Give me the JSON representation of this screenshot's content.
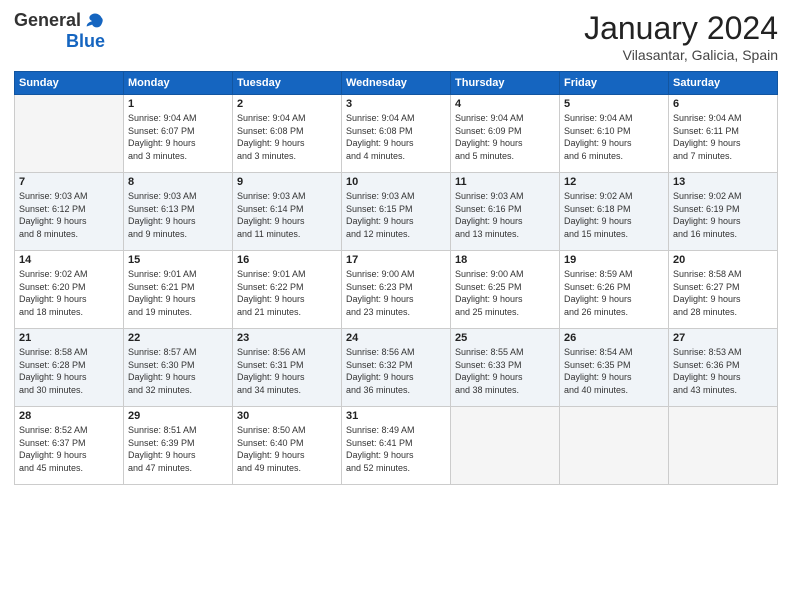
{
  "header": {
    "logo_general": "General",
    "logo_blue": "Blue",
    "month_title": "January 2024",
    "location": "Vilasantar, Galicia, Spain"
  },
  "days_of_week": [
    "Sunday",
    "Monday",
    "Tuesday",
    "Wednesday",
    "Thursday",
    "Friday",
    "Saturday"
  ],
  "weeks": [
    [
      {
        "day": "",
        "info": ""
      },
      {
        "day": "1",
        "info": "Sunrise: 9:04 AM\nSunset: 6:07 PM\nDaylight: 9 hours\nand 3 minutes."
      },
      {
        "day": "2",
        "info": "Sunrise: 9:04 AM\nSunset: 6:08 PM\nDaylight: 9 hours\nand 3 minutes."
      },
      {
        "day": "3",
        "info": "Sunrise: 9:04 AM\nSunset: 6:08 PM\nDaylight: 9 hours\nand 4 minutes."
      },
      {
        "day": "4",
        "info": "Sunrise: 9:04 AM\nSunset: 6:09 PM\nDaylight: 9 hours\nand 5 minutes."
      },
      {
        "day": "5",
        "info": "Sunrise: 9:04 AM\nSunset: 6:10 PM\nDaylight: 9 hours\nand 6 minutes."
      },
      {
        "day": "6",
        "info": "Sunrise: 9:04 AM\nSunset: 6:11 PM\nDaylight: 9 hours\nand 7 minutes."
      }
    ],
    [
      {
        "day": "7",
        "info": "Sunrise: 9:03 AM\nSunset: 6:12 PM\nDaylight: 9 hours\nand 8 minutes."
      },
      {
        "day": "8",
        "info": "Sunrise: 9:03 AM\nSunset: 6:13 PM\nDaylight: 9 hours\nand 9 minutes."
      },
      {
        "day": "9",
        "info": "Sunrise: 9:03 AM\nSunset: 6:14 PM\nDaylight: 9 hours\nand 11 minutes."
      },
      {
        "day": "10",
        "info": "Sunrise: 9:03 AM\nSunset: 6:15 PM\nDaylight: 9 hours\nand 12 minutes."
      },
      {
        "day": "11",
        "info": "Sunrise: 9:03 AM\nSunset: 6:16 PM\nDaylight: 9 hours\nand 13 minutes."
      },
      {
        "day": "12",
        "info": "Sunrise: 9:02 AM\nSunset: 6:18 PM\nDaylight: 9 hours\nand 15 minutes."
      },
      {
        "day": "13",
        "info": "Sunrise: 9:02 AM\nSunset: 6:19 PM\nDaylight: 9 hours\nand 16 minutes."
      }
    ],
    [
      {
        "day": "14",
        "info": "Sunrise: 9:02 AM\nSunset: 6:20 PM\nDaylight: 9 hours\nand 18 minutes."
      },
      {
        "day": "15",
        "info": "Sunrise: 9:01 AM\nSunset: 6:21 PM\nDaylight: 9 hours\nand 19 minutes."
      },
      {
        "day": "16",
        "info": "Sunrise: 9:01 AM\nSunset: 6:22 PM\nDaylight: 9 hours\nand 21 minutes."
      },
      {
        "day": "17",
        "info": "Sunrise: 9:00 AM\nSunset: 6:23 PM\nDaylight: 9 hours\nand 23 minutes."
      },
      {
        "day": "18",
        "info": "Sunrise: 9:00 AM\nSunset: 6:25 PM\nDaylight: 9 hours\nand 25 minutes."
      },
      {
        "day": "19",
        "info": "Sunrise: 8:59 AM\nSunset: 6:26 PM\nDaylight: 9 hours\nand 26 minutes."
      },
      {
        "day": "20",
        "info": "Sunrise: 8:58 AM\nSunset: 6:27 PM\nDaylight: 9 hours\nand 28 minutes."
      }
    ],
    [
      {
        "day": "21",
        "info": "Sunrise: 8:58 AM\nSunset: 6:28 PM\nDaylight: 9 hours\nand 30 minutes."
      },
      {
        "day": "22",
        "info": "Sunrise: 8:57 AM\nSunset: 6:30 PM\nDaylight: 9 hours\nand 32 minutes."
      },
      {
        "day": "23",
        "info": "Sunrise: 8:56 AM\nSunset: 6:31 PM\nDaylight: 9 hours\nand 34 minutes."
      },
      {
        "day": "24",
        "info": "Sunrise: 8:56 AM\nSunset: 6:32 PM\nDaylight: 9 hours\nand 36 minutes."
      },
      {
        "day": "25",
        "info": "Sunrise: 8:55 AM\nSunset: 6:33 PM\nDaylight: 9 hours\nand 38 minutes."
      },
      {
        "day": "26",
        "info": "Sunrise: 8:54 AM\nSunset: 6:35 PM\nDaylight: 9 hours\nand 40 minutes."
      },
      {
        "day": "27",
        "info": "Sunrise: 8:53 AM\nSunset: 6:36 PM\nDaylight: 9 hours\nand 43 minutes."
      }
    ],
    [
      {
        "day": "28",
        "info": "Sunrise: 8:52 AM\nSunset: 6:37 PM\nDaylight: 9 hours\nand 45 minutes."
      },
      {
        "day": "29",
        "info": "Sunrise: 8:51 AM\nSunset: 6:39 PM\nDaylight: 9 hours\nand 47 minutes."
      },
      {
        "day": "30",
        "info": "Sunrise: 8:50 AM\nSunset: 6:40 PM\nDaylight: 9 hours\nand 49 minutes."
      },
      {
        "day": "31",
        "info": "Sunrise: 8:49 AM\nSunset: 6:41 PM\nDaylight: 9 hours\nand 52 minutes."
      },
      {
        "day": "",
        "info": ""
      },
      {
        "day": "",
        "info": ""
      },
      {
        "day": "",
        "info": ""
      }
    ]
  ]
}
